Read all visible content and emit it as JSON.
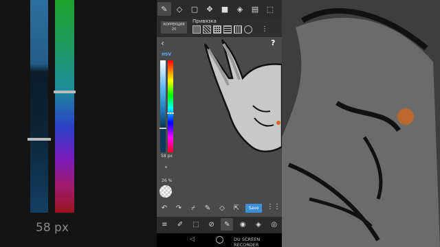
{
  "left_blur": {
    "size_label": "58 px"
  },
  "toolbar": {
    "tools": [
      "pen-icon",
      "eraser-icon",
      "select-rect-icon",
      "move-icon",
      "fill-rect-icon",
      "bucket-icon",
      "gradient-icon",
      "selection-icon"
    ]
  },
  "sub_bar": {
    "correction_label": "КОРРЕКЦИЯ",
    "correction_value": "20",
    "snap_label": "Привязка",
    "snap_icons": [
      "off",
      "parallel",
      "grid",
      "horizontal",
      "vertical",
      "circle"
    ]
  },
  "brush_panel": {
    "mode_label": "HSV",
    "size_label": "58 px",
    "opacity_label": "26 %"
  },
  "actions": {
    "save_label": "Save"
  },
  "bottom_tabs": [
    "menu",
    "edit",
    "select",
    "transform",
    "brush",
    "palette",
    "layers",
    "settings"
  ],
  "system_nav": {
    "recorder_label": "DU SCREEN RECORDER"
  },
  "colors": {
    "accent": "#3c8fd8",
    "canvas": "#4a4a4a",
    "bg": "#2b2b2b"
  }
}
